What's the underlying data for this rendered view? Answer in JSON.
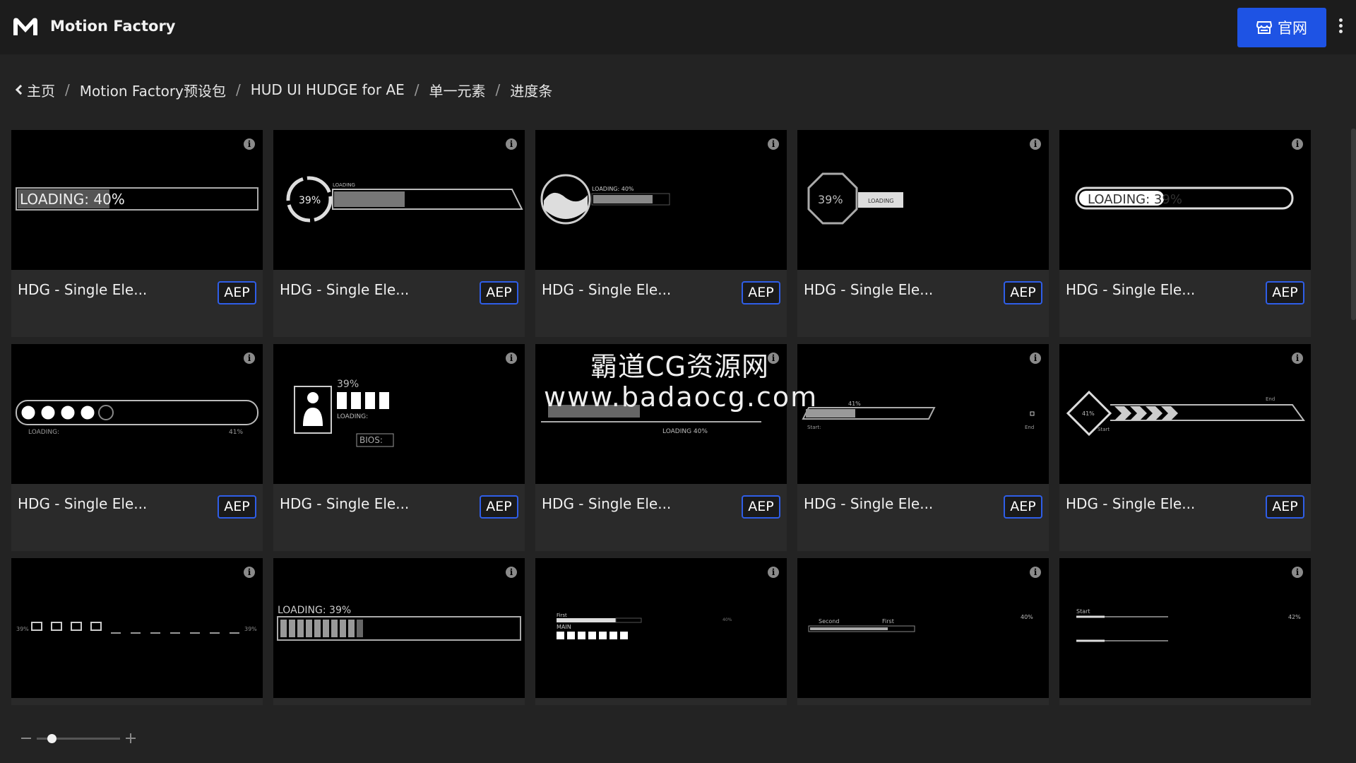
{
  "app": {
    "title": "Motion Factory",
    "logo_icon": "mf-logo-icon"
  },
  "header": {
    "site_button_label": "官网",
    "site_button_icon": "store-icon",
    "menu_icon": "kebab-menu-icon",
    "accent_color": "#1e53e4"
  },
  "breadcrumb": {
    "back_icon": "chevron-left-icon",
    "items": [
      "主页",
      "Motion Factory预设包",
      "HUD UI HUDGE for AE",
      "单一元素",
      "进度条"
    ],
    "separator": "/"
  },
  "cards": [
    {
      "title": "HDG - Single Ele...",
      "badge": "AEP",
      "preview": "LOADING: 40%"
    },
    {
      "title": "HDG - Single Ele...",
      "badge": "AEP",
      "preview": "39%"
    },
    {
      "title": "HDG - Single Ele...",
      "badge": "AEP",
      "preview": "LOADING: 40%"
    },
    {
      "title": "HDG - Single Ele...",
      "badge": "AEP",
      "preview": "39%"
    },
    {
      "title": "HDG - Single Ele...",
      "badge": "AEP",
      "preview": "LOADING: 39%"
    },
    {
      "title": "HDG - Single Ele...",
      "badge": "AEP",
      "preview": "LOADING:"
    },
    {
      "title": "HDG - Single Ele...",
      "badge": "AEP",
      "preview": "39%"
    },
    {
      "title": "HDG - Single Ele...",
      "badge": "AEP",
      "preview": "LOADING 40%"
    },
    {
      "title": "HDG - Single Ele...",
      "badge": "AEP",
      "preview": "41%"
    },
    {
      "title": "HDG - Single Ele...",
      "badge": "AEP",
      "preview": "41%"
    },
    {
      "title": "",
      "badge": "",
      "preview": ""
    },
    {
      "title": "",
      "badge": "",
      "preview": "LOADING: 39%"
    },
    {
      "title": "",
      "badge": "",
      "preview": "MAIN"
    },
    {
      "title": "",
      "badge": "",
      "preview": "Second"
    },
    {
      "title": "",
      "badge": "",
      "preview": "Start"
    }
  ],
  "thumb_texts": {
    "t1_label": "LOADING: 40%",
    "t2_pct": "39%",
    "t2_small": "LOADING",
    "t3_label": "LOADING: 40%",
    "t4_pct": "39%",
    "t4_small": "LOADING",
    "t5_label": "LOADING: 39%",
    "t6_label": "LOADING:",
    "t6_pct": "41%",
    "t7_pct": "39%",
    "t7_loading": "LOADING:",
    "t7_bios": "BIOS:",
    "t8_label": "LOADING 40%",
    "t9_pct": "41%",
    "t9_start": "Start:",
    "t9_end": "End",
    "t10_pct": "41%",
    "t10_start": "Start",
    "t10_end": "End",
    "t11_left": "39%",
    "t11_right": "39%",
    "t12_label": "LOADING: 39%",
    "t13_first": "First",
    "t13_main": "MAIN",
    "t13_pct": "40%",
    "t14_second": "Second",
    "t14_first": "First",
    "t14_pct": "40%",
    "t15_start": "Start",
    "t15_pct": "42%"
  },
  "watermark": {
    "line1": "霸道CG资源网",
    "line2": "www.badaocg.com"
  },
  "zoom": {
    "minus_icon": "zoom-out-icon",
    "plus_icon": "zoom-in-icon",
    "level": 0.18
  }
}
